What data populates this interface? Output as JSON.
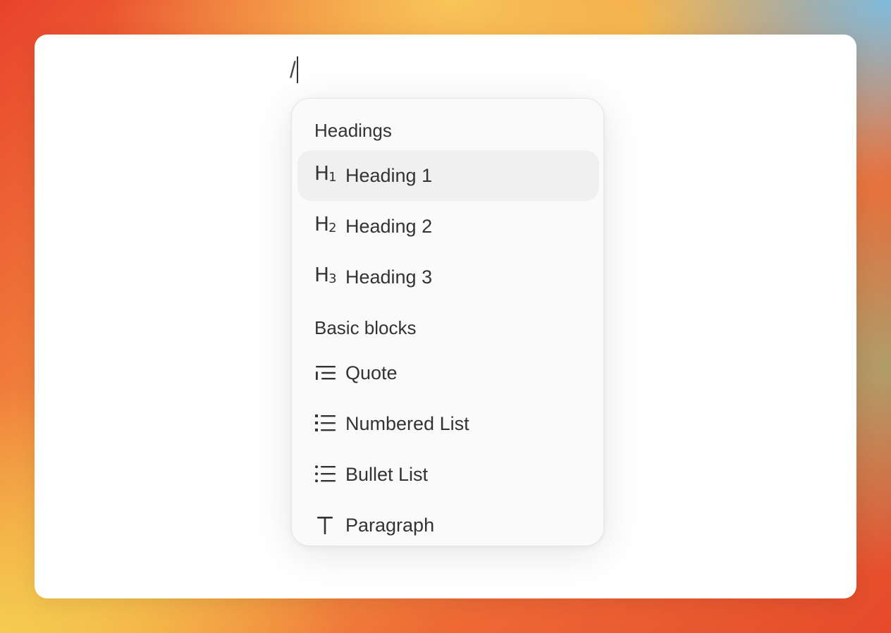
{
  "editor": {
    "input_text": "/"
  },
  "slash_menu": {
    "sections": [
      {
        "label": "Headings",
        "items": [
          {
            "label": "Heading 1",
            "icon": "heading-1-icon",
            "icon_main": "H",
            "icon_sub": "1",
            "selected": true
          },
          {
            "label": "Heading 2",
            "icon": "heading-2-icon",
            "icon_main": "H",
            "icon_sub": "2",
            "selected": false
          },
          {
            "label": "Heading 3",
            "icon": "heading-3-icon",
            "icon_main": "H",
            "icon_sub": "3",
            "selected": false
          }
        ]
      },
      {
        "label": "Basic blocks",
        "items": [
          {
            "label": "Quote",
            "icon": "quote-icon",
            "selected": false
          },
          {
            "label": "Numbered List",
            "icon": "numbered-list-icon",
            "selected": false
          },
          {
            "label": "Bullet List",
            "icon": "bullet-list-icon",
            "selected": false
          },
          {
            "label": "Paragraph",
            "icon": "paragraph-icon",
            "selected": false
          }
        ]
      }
    ]
  },
  "colors": {
    "text": "#333336",
    "selected_bg": "#f0f0f0",
    "menu_bg": "#fafafa"
  }
}
